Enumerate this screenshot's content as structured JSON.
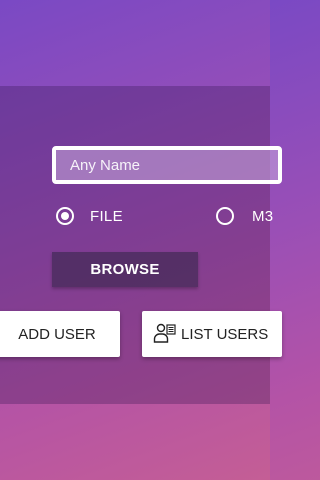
{
  "form": {
    "name_placeholder": "Any Name",
    "name_value": ""
  },
  "source_options": [
    {
      "label": "FILE",
      "selected": true
    },
    {
      "label": "M3",
      "selected": false
    }
  ],
  "buttons": {
    "browse": "BROWSE",
    "add_user": "ADD USER",
    "list_users": "LIST USERS"
  },
  "icons": {
    "list_users": "users-list-icon"
  }
}
